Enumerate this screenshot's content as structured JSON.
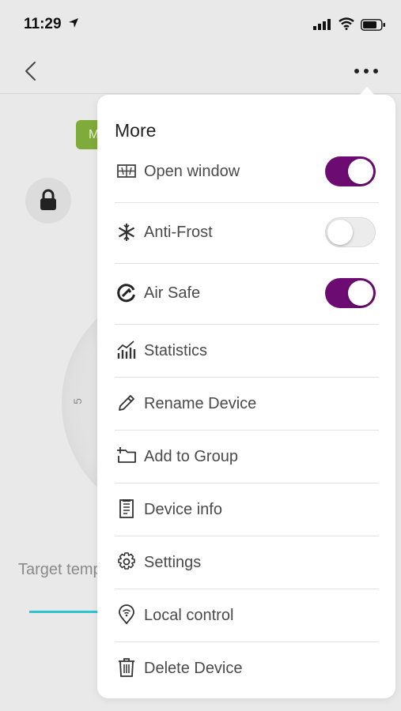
{
  "status_bar": {
    "time": "11:29"
  },
  "background": {
    "mode_chip_letter": "M",
    "dial_mark": "5",
    "target_label": "Target temperature"
  },
  "menu": {
    "title": "More",
    "items": [
      {
        "label": "Open window",
        "icon": "window-icon",
        "toggle": true,
        "on": true
      },
      {
        "label": "Anti-Frost",
        "icon": "snowflake-icon",
        "toggle": true,
        "on": false
      },
      {
        "label": "Air Safe",
        "icon": "air-safe-icon",
        "toggle": true,
        "on": true
      },
      {
        "label": "Statistics",
        "icon": "statistics-icon",
        "toggle": false
      },
      {
        "label": "Rename Device",
        "icon": "pencil-icon",
        "toggle": false
      },
      {
        "label": "Add to Group",
        "icon": "add-folder-icon",
        "toggle": false
      },
      {
        "label": "Device info",
        "icon": "document-icon",
        "toggle": false
      },
      {
        "label": "Settings",
        "icon": "gear-icon",
        "toggle": false
      },
      {
        "label": "Local control",
        "icon": "location-pin-icon",
        "toggle": false
      },
      {
        "label": "Delete Device",
        "icon": "trash-icon",
        "toggle": false
      }
    ]
  },
  "colors": {
    "toggle_on": "#6c0b72",
    "mode_chip": "#7fab3a",
    "accent_line": "#2ec3d0"
  }
}
